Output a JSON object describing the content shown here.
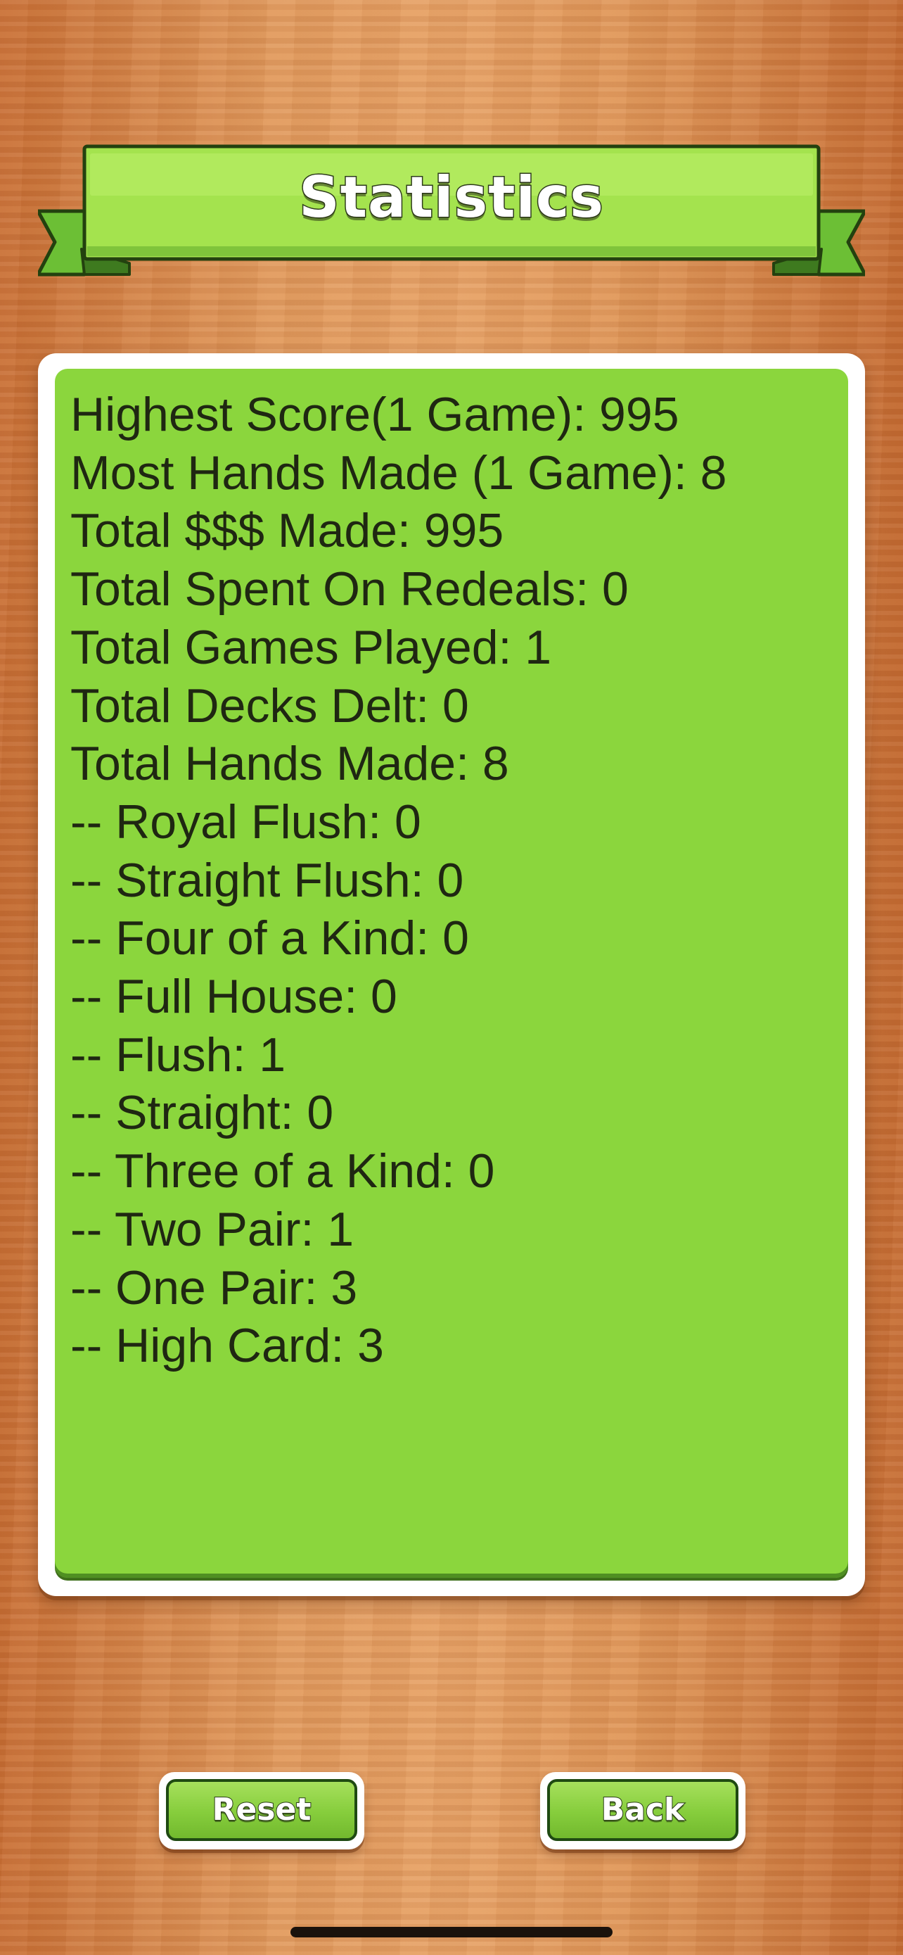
{
  "title": "Statistics",
  "stats": [
    "Highest Score(1 Game): 995",
    "Most Hands Made (1 Game): 8",
    "Total $$$ Made: 995",
    "Total Spent On Redeals: 0",
    "Total Games Played: 1",
    "Total Decks Delt: 0",
    "Total Hands Made: 8",
    "-- Royal Flush: 0",
    "-- Straight Flush: 0",
    "-- Four of a Kind: 0",
    "-- Full House: 0",
    "-- Flush: 1",
    "-- Straight: 0",
    "-- Three of a Kind: 0",
    "-- Two Pair: 1",
    "-- One Pair: 3",
    "-- High Card: 3"
  ],
  "buttons": {
    "reset": "Reset",
    "back": "Back"
  },
  "colors": {
    "panel_green": "#8bd63d",
    "banner_green": "#a4e34e",
    "wood": "#d88a4c",
    "text": "#1f2712"
  }
}
